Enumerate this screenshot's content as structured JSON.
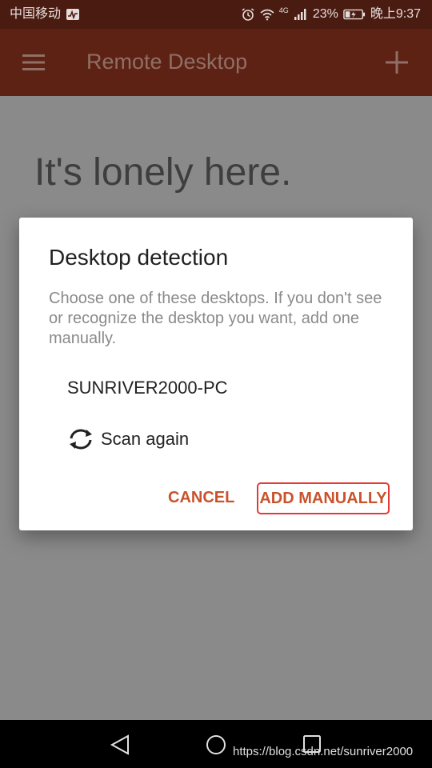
{
  "status_bar": {
    "carrier": "中国移动",
    "network": "4G",
    "battery": "23%",
    "time": "晚上9:37",
    "icons": [
      "activity-icon",
      "alarm-icon",
      "wifi-icon",
      "signal-icon",
      "battery-icon"
    ]
  },
  "app_bar": {
    "title": "Remote Desktop",
    "menu_icon": "hamburger-menu-icon",
    "add_icon": "plus-icon"
  },
  "empty_state": {
    "heading": "It's lonely here."
  },
  "dialog": {
    "title": "Desktop detection",
    "message": "Choose one of these desktops. If you don't see or recognize the desktop you want, add one manually.",
    "desktops": [
      "SUNRIVER2000-PC"
    ],
    "scan_label": "Scan again",
    "scan_icon": "refresh-icon",
    "cancel_label": "CANCEL",
    "add_manually_label": "ADD MANUALLY"
  },
  "nav_bar": {
    "icons": [
      "back-icon",
      "home-icon",
      "recent-apps-icon"
    ]
  },
  "watermark": "https://blog.csdn.net/sunriver2000",
  "colors": {
    "status_bar": "#4a1b11",
    "app_bar": "#5d2214",
    "scrim_background": "#8a8a8a",
    "accent": "#c8532c",
    "highlight_border": "#e53935"
  }
}
